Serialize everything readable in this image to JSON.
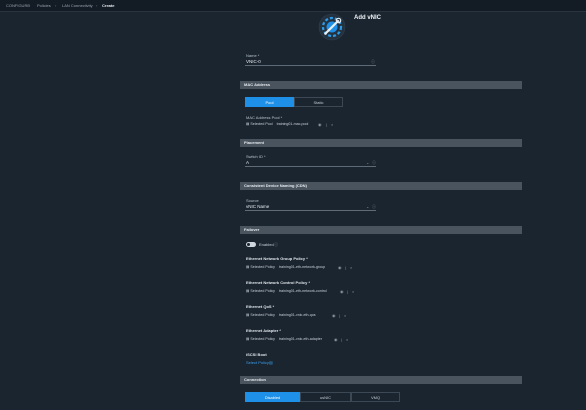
{
  "breadcrumb": [
    "CONFIGURE",
    "Policies",
    "LAN Connectivity",
    "Create"
  ],
  "page": {
    "title": "Add vNIC"
  },
  "name_field": {
    "label": "Name *",
    "value": "VNIC-0"
  },
  "sections": {
    "mac": "MAC Address",
    "placement": "Placement",
    "cdn": "Consistent Device Naming (CDN)",
    "failover": "Failover",
    "connection": "Connection"
  },
  "mac": {
    "pool_label": "Pool",
    "static_label": "Static",
    "pool_field_label": "MAC Address Pool *",
    "selected_prefix": "Selected Pool",
    "pool_value": "training01-mac-pool"
  },
  "placement": {
    "switch_label": "Switch ID *",
    "switch_value": "A"
  },
  "cdn": {
    "source_label": "Source",
    "source_value": "vNIC Name"
  },
  "failover": {
    "enabled_label": "Enabled"
  },
  "policies": [
    {
      "label": "Ethernet Network Group Policy *",
      "prefix": "Selected Policy",
      "value": "training01-eth-network-group"
    },
    {
      "label": "Ethernet Network Control Policy *",
      "prefix": "Selected Policy",
      "value": "training01-eth-network-control"
    },
    {
      "label": "Ethernet QoS *",
      "prefix": "Selected Policy",
      "value": "training01-vnic-eth-qos"
    },
    {
      "label": "Ethernet Adapter *",
      "prefix": "Selected Policy",
      "value": "training01-vnic-eth-adapter"
    }
  ],
  "iscsi": {
    "label": "iSCSI Boot",
    "link": "Select Policy"
  },
  "connection": {
    "tabs": [
      "Disabled",
      "usNIC",
      "VMQ"
    ]
  },
  "colors": {
    "accent": "#1e90e8",
    "background": "#1b2530",
    "section": "#4a545f"
  }
}
